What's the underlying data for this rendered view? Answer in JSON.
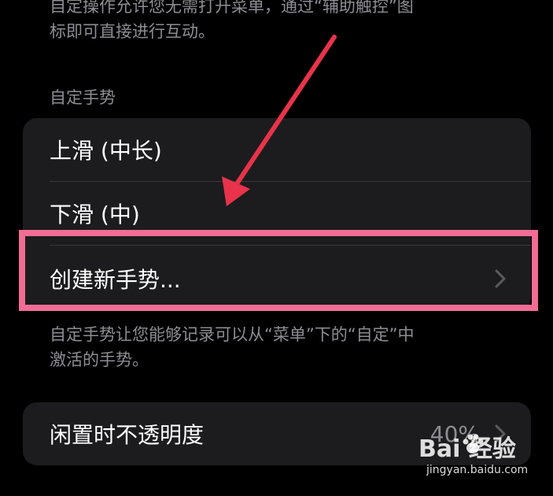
{
  "top_note": "自定操作允许您无需打开菜单，通过“辅助触控”图\n标即可直接进行互动。",
  "section_header": "自定手势",
  "gestures": {
    "items": [
      {
        "label": "上滑 (中长)"
      },
      {
        "label": "下滑 (中)"
      },
      {
        "label": "创建新手势..."
      }
    ]
  },
  "bottom_note": "自定手势让您能够记录可以从“菜单”下的“自定”中\n激活的手势。",
  "opacity": {
    "label": "闲置时不透明度",
    "value": "40%"
  },
  "watermark": {
    "logo": "Bai 经验",
    "url": "jingyan.baidu.com"
  },
  "colors": {
    "background": "#000000",
    "group_bg": "#1c1c1e",
    "secondary_text": "#8d8d93",
    "highlight": "#f06d95",
    "arrow": "#e8334a"
  },
  "icons": [
    "chevron-right-icon",
    "red-arrow-annotation",
    "baidu-paw-icon"
  ]
}
